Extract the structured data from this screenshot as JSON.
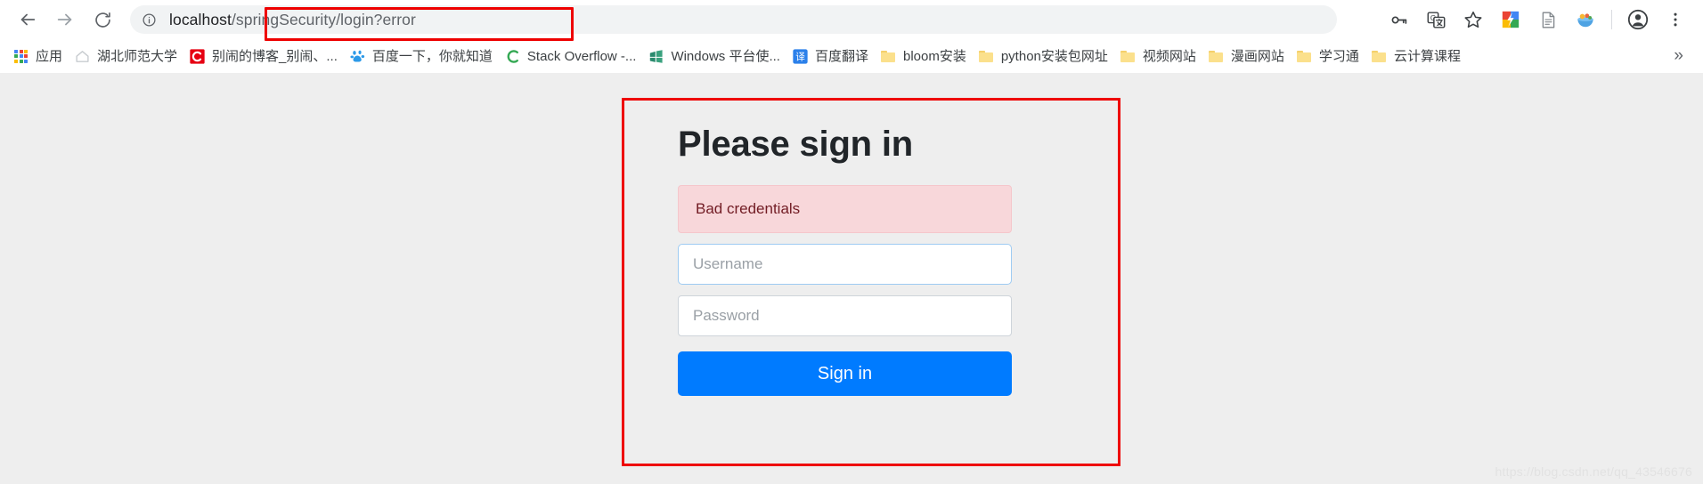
{
  "browser": {
    "nav": {
      "back_icon": "arrow-back-icon",
      "forward_icon": "arrow-forward-icon",
      "reload_icon": "reload-icon"
    },
    "omnibox": {
      "site_info_icon": "info-circle-icon",
      "url_host": "localhost",
      "url_path": "/springSecurity/login?error",
      "full_url": "localhost/springSecurity/login?error"
    },
    "toolbar_right": [
      {
        "name": "password-key-icon",
        "glyph": "key"
      },
      {
        "name": "google-translate-icon",
        "glyph": "translate"
      },
      {
        "name": "bookmark-star-icon",
        "glyph": "star"
      },
      {
        "name": "extension-colorful-icon",
        "glyph": "flash"
      },
      {
        "name": "extension-document-icon",
        "glyph": "document"
      },
      {
        "name": "extension-bowl-icon",
        "glyph": "bowl"
      },
      {
        "name": "profile-avatar-icon",
        "glyph": "person"
      },
      {
        "name": "chrome-menu-icon",
        "glyph": "kebab"
      }
    ],
    "bookmarks": [
      {
        "label": "应用",
        "icon": "apps-grid-icon"
      },
      {
        "label": "湖北师范大学",
        "icon": "house-icon"
      },
      {
        "label": "别闹的博客_别闹、...",
        "icon": "csdn-icon"
      },
      {
        "label": "百度一下，你就知道",
        "icon": "baidu-icon"
      },
      {
        "label": "Stack Overflow -...",
        "icon": "stackoverflow-icon"
      },
      {
        "label": "Windows 平台使...",
        "icon": "windows-icon"
      },
      {
        "label": "百度翻译",
        "icon": "baidu-translate-icon"
      },
      {
        "label": "bloom安装",
        "icon": "folder-icon"
      },
      {
        "label": "python安装包网址",
        "icon": "folder-icon"
      },
      {
        "label": "视频网站",
        "icon": "folder-icon"
      },
      {
        "label": "漫画网站",
        "icon": "folder-icon"
      },
      {
        "label": "学习通",
        "icon": "folder-icon"
      },
      {
        "label": "云计算课程",
        "icon": "folder-icon"
      }
    ],
    "bookmark_overflow_label": "»"
  },
  "page": {
    "heading": "Please sign in",
    "error_message": "Bad credentials",
    "username_placeholder": "Username",
    "password_placeholder": "Password",
    "signin_button_label": "Sign in",
    "watermark": "https://blog.csdn.net/qq_43546676"
  },
  "colors": {
    "annotation_red": "#ee0000",
    "primary_blue": "#007bff",
    "alert_bg": "#f8d7da",
    "alert_border": "#f5c6cb",
    "alert_text": "#721c24",
    "page_bg": "#eeeeee",
    "omnibox_bg": "#f1f3f4",
    "focused_border": "#9ecbf2"
  }
}
